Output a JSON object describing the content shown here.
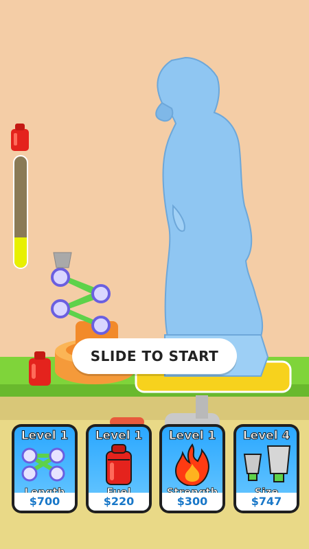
{
  "fuel": {
    "level_fraction": 0.27,
    "icon": "fuel-canister-icon"
  },
  "prompt": {
    "text": "SLIDE TO START"
  },
  "upgrades": [
    {
      "level": "Level 1",
      "label": "Length",
      "price": "$700",
      "icon": "hose-links-icon"
    },
    {
      "level": "Level 1",
      "label": "Fuel",
      "price": "$220",
      "icon": "fuel-canister-icon"
    },
    {
      "level": "Level 1",
      "label": "Strength",
      "price": "$300",
      "icon": "flame-icon"
    },
    {
      "level": "Level 4",
      "label": "Size",
      "price": "$747",
      "icon": "nozzles-icon"
    }
  ],
  "colors": {
    "background": "#f4cda6",
    "ground": "#7fd43a",
    "ice": "#8fc6f2",
    "card_blue": "#2aa7ff",
    "price_text": "#1877c8",
    "fuel_fill": "#e8f000"
  }
}
